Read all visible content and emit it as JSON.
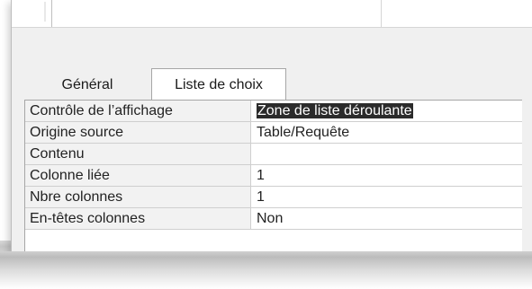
{
  "tabs": [
    {
      "label": "Général"
    },
    {
      "label": "Liste de choix"
    }
  ],
  "properties": [
    {
      "name": "Contrôle de l’affichage",
      "value": "Zone de liste déroulante"
    },
    {
      "name": "Origine source",
      "value": "Table/Requête"
    },
    {
      "name": "Contenu",
      "value": ""
    },
    {
      "name": "Colonne liée",
      "value": "1"
    },
    {
      "name": "Nbre colonnes",
      "value": "1"
    },
    {
      "name": "En-têtes colonnes",
      "value": "Non"
    }
  ]
}
